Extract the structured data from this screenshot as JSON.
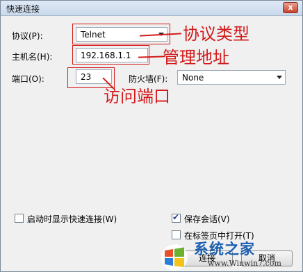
{
  "window": {
    "title": "快速连接",
    "close_label": "x"
  },
  "form": {
    "protocol_label": "协议(P):",
    "protocol_value": "Telnet",
    "hostname_label": "主机名(H):",
    "hostname_value": "192.168.1.1",
    "port_label": "端口(O):",
    "port_value": "23",
    "firewall_label": "防火墙(F):",
    "firewall_value": "None"
  },
  "annotations": {
    "protocol_type": "协议类型",
    "manage_address": "管理地址",
    "access_port": "访问端口",
    "color": "#d21a1a"
  },
  "options": {
    "startup_show": "启动时显示快速连接(W)",
    "save_session": "保存会话(V)",
    "open_in_tab": "在标签页中打开(T)",
    "save_session_checked": true,
    "open_in_tab_checked": false,
    "startup_show_checked": false
  },
  "buttons": {
    "connect": "连接",
    "cancel": "取消"
  },
  "watermark": {
    "brand": "系统之家",
    "url": "www.Winwin7.com"
  }
}
